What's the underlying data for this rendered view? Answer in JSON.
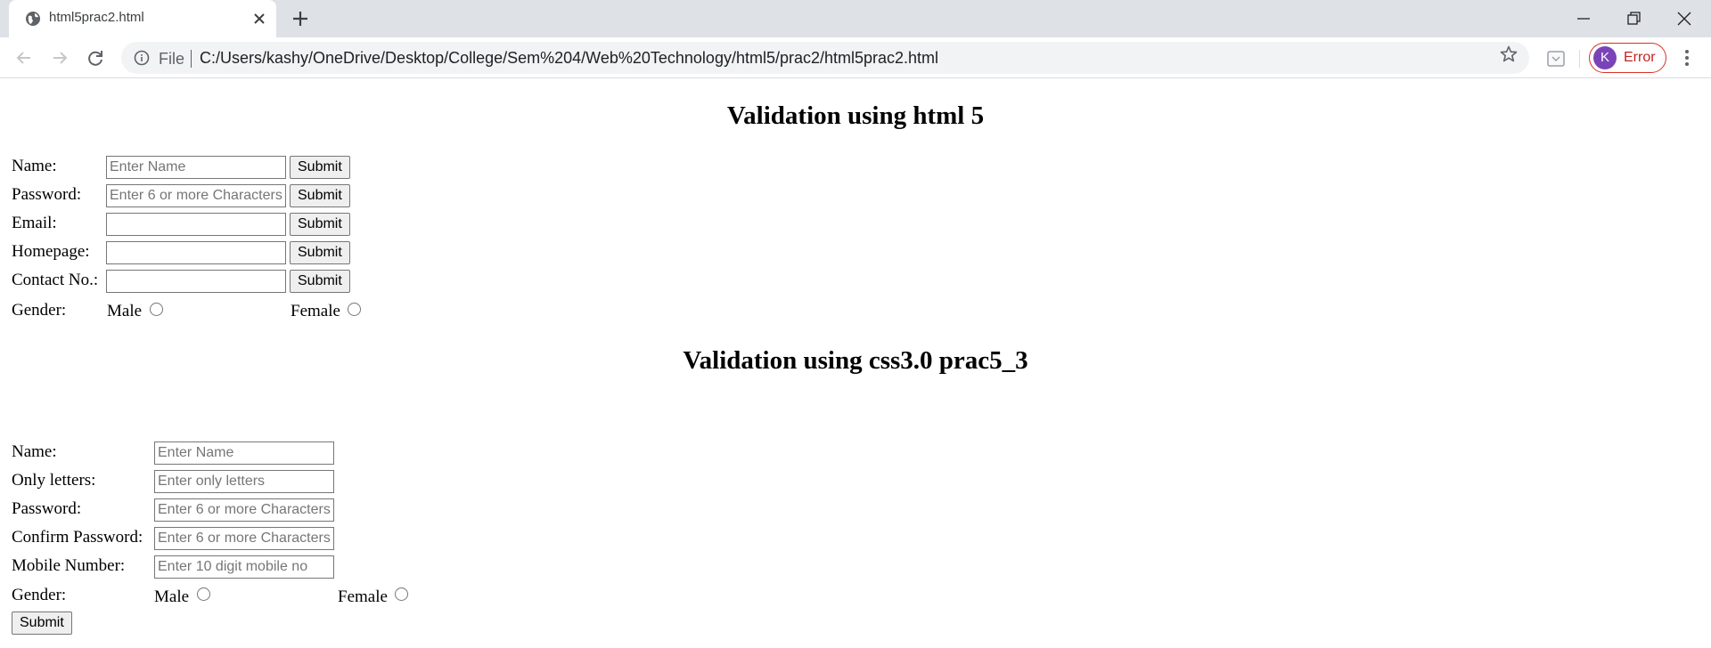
{
  "browser": {
    "tab_title": "html5prac2.html",
    "omnibox": {
      "scheme_label": "File",
      "url": "C:/Users/kashy/OneDrive/Desktop/College/Sem%204/Web%20Technology/html5/prac2/html5prac2.html"
    },
    "profile": {
      "initial": "K",
      "status": "Error"
    },
    "colors": {
      "tabstrip": "#dee1e6",
      "omnibox": "#f1f3f4",
      "profile_error": "#d93025",
      "avatar": "#7a44b9"
    },
    "icons": [
      "globe-icon",
      "close-icon",
      "plus-icon",
      "minimize-icon",
      "restore-icon",
      "window-close-icon",
      "back-arrow-icon",
      "forward-arrow-icon",
      "reload-icon",
      "info-icon",
      "star-icon",
      "extension-icon",
      "kebab-menu-icon"
    ]
  },
  "page": {
    "section1": {
      "heading": "Validation using html 5",
      "rows": [
        {
          "label": "Name:",
          "placeholder": "Enter Name",
          "button": "Submit"
        },
        {
          "label": "Password:",
          "placeholder": "Enter 6 or more Characters",
          "button": "Submit"
        },
        {
          "label": "Email:",
          "placeholder": "",
          "button": "Submit"
        },
        {
          "label": "Homepage:",
          "placeholder": "",
          "button": "Submit"
        },
        {
          "label": "Contact No.:",
          "placeholder": "",
          "button": "Submit"
        }
      ],
      "gender": {
        "label": "Gender:",
        "male": "Male",
        "female": "Female"
      }
    },
    "section2": {
      "heading": "Validation using css3.0 prac5_3",
      "rows": [
        {
          "label": "Name:",
          "placeholder": "Enter Name"
        },
        {
          "label": "Only letters:",
          "placeholder": "Enter only letters"
        },
        {
          "label": "Password:",
          "placeholder": "Enter 6 or more Characters"
        },
        {
          "label": "Confirm Password:",
          "placeholder": "Enter 6 or more Characters"
        },
        {
          "label": "Mobile Number:",
          "placeholder": "Enter 10 digit mobile no"
        }
      ],
      "gender": {
        "label": "Gender:",
        "male": "Male",
        "female": "Female"
      },
      "submit": "Submit"
    }
  }
}
